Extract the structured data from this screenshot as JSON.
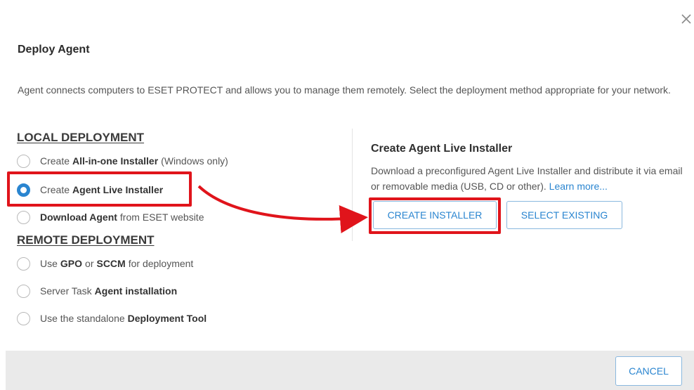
{
  "dialog": {
    "title": "Deploy Agent",
    "description": "Agent connects computers to ESET PROTECT and allows you to manage them remotely. Select the deployment method appropriate for your network.",
    "close_icon": "close-icon"
  },
  "local": {
    "heading": "LOCAL DEPLOYMENT",
    "options": [
      {
        "prefix": "Create",
        "bold": "All-in-one Installer",
        "suffix": "(Windows only)",
        "selected": false
      },
      {
        "prefix": "Create",
        "bold": "Agent Live Installer",
        "suffix": "",
        "selected": true
      },
      {
        "prefix": "",
        "bold": "Download Agent",
        "suffix": "from ESET website",
        "selected": false
      }
    ]
  },
  "remote": {
    "heading": "REMOTE DEPLOYMENT",
    "options": [
      {
        "prefix": "Use",
        "bold": "GPO",
        "middle": "or",
        "bold2": "SCCM",
        "suffix": "for deployment",
        "selected": false
      },
      {
        "prefix": "Server Task",
        "bold": "Agent installation",
        "suffix": "",
        "selected": false
      },
      {
        "prefix": "Use the standalone",
        "bold": "Deployment Tool",
        "suffix": "",
        "selected": false
      }
    ]
  },
  "panel": {
    "title": "Create Agent Live Installer",
    "description": "Download a preconfigured Agent Live Installer and distribute it via email or removable media (USB, CD or other).",
    "learn_more": "Learn more...",
    "create_button": "CREATE INSTALLER",
    "select_button": "SELECT EXISTING"
  },
  "footer": {
    "cancel_button": "CANCEL"
  },
  "colors": {
    "accent": "#2a85d0",
    "highlight": "#e0141b",
    "footer_bg": "#eaeaea"
  }
}
